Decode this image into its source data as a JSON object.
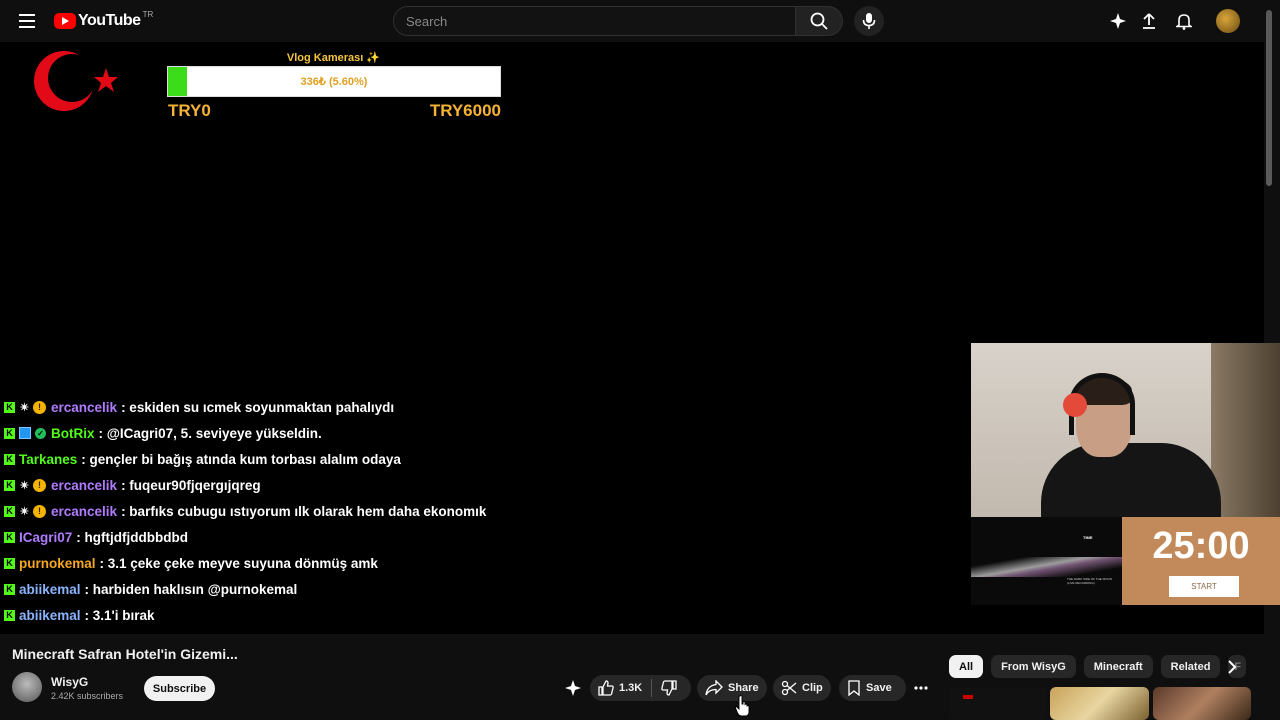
{
  "header": {
    "logo_text": "YouTube",
    "logo_region": "TR",
    "search_placeholder": "Search"
  },
  "stream_overlay": {
    "goal": {
      "title": "Vlog Kamerası ✨",
      "progress_text": "336₺ (5.60%)",
      "progress_fraction": 0.056,
      "min_label": "TRY0",
      "max_label": "TRY6000"
    },
    "chat": [
      {
        "badges": [
          "k",
          "star",
          "coin"
        ],
        "user": "ercancelik",
        "user_color": "#b07cff",
        "message": ": eskiden su ıcmek soyunmaktan pahalıydı"
      },
      {
        "badges": [
          "k",
          "bot",
          "check"
        ],
        "user": "BotRix",
        "user_color": "#53fc18",
        "message": ": @ICagri07, 5. seviyeye yükseldin."
      },
      {
        "badges": [
          "k"
        ],
        "user": "Tarkanes",
        "user_color": "#53fc18",
        "message": ": gençler bi bağış atında kum torbası alalım odaya"
      },
      {
        "badges": [
          "k",
          "star",
          "coin"
        ],
        "user": "ercancelik",
        "user_color": "#b07cff",
        "message": ": fuqeur90fjqergıjqreg"
      },
      {
        "badges": [
          "k",
          "star",
          "coin"
        ],
        "user": "ercancelik",
        "user_color": "#b07cff",
        "message": ": barfıks cubugu ıstıyorum ılk olarak hem daha ekonomık"
      },
      {
        "badges": [
          "k"
        ],
        "user": "ICagri07",
        "user_color": "#b07cff",
        "message": ": hgftjdfjddbbdbd"
      },
      {
        "badges": [
          "k"
        ],
        "user": "purnokemal",
        "user_color": "#f5a623",
        "message": ": 3.1 çeke çeke meyve suyuna dönmüş amk"
      },
      {
        "badges": [
          "k"
        ],
        "user": "abiikemal",
        "user_color": "#8ab4ff",
        "message": ": harbiden haklısın @purnokemal"
      },
      {
        "badges": [
          "k"
        ],
        "user": "abiikemal",
        "user_color": "#8ab4ff",
        "message": ": 3.1'i bırak"
      }
    ],
    "mini_player": {
      "title": "TIME",
      "caption": "THE DARK SIDE OF THE MOON (LIVE RECORDING)"
    },
    "timer": {
      "value": "25:00",
      "button_label": "START"
    }
  },
  "video_info": {
    "title": "Minecraft Safran Hotel'in Gizemi...",
    "channel_name": "WisyG",
    "subscribers": "2.42K subscribers",
    "subscribe_label": "Subscribe",
    "like_count": "1.3K",
    "share_label": "Share",
    "clip_label": "Clip",
    "save_label": "Save"
  },
  "chips": [
    "All",
    "From WisyG",
    "Minecraft",
    "Related",
    "F"
  ],
  "colors": {
    "background": "#0f0f0f",
    "youtube_red": "#ff0000",
    "kick_green": "#53fc18",
    "goal_gold": "#f5b335",
    "timer_bg": "#c28a5a"
  }
}
